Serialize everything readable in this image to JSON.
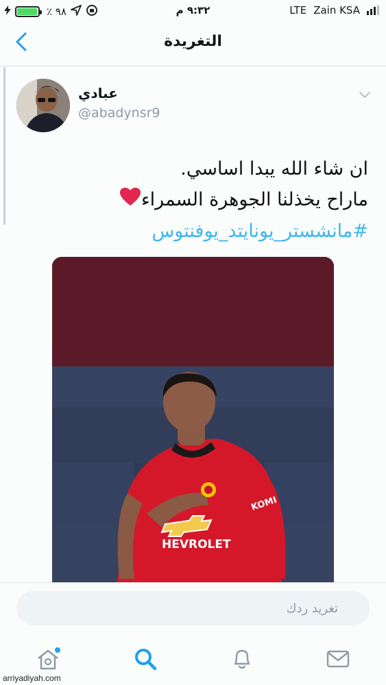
{
  "status_bar": {
    "battery_percent": "٪ ٩٨",
    "battery_level": 0.98,
    "time": "٩:٣٢ م",
    "network": "LTE",
    "carrier": "Zain KSA"
  },
  "nav": {
    "title": "التغريدة",
    "back_icon": "chevron-left-icon"
  },
  "tweet": {
    "author_name": "عبادي",
    "author_handle": "@abadynsr9",
    "lines": [
      "ان شاء الله يبدا اساسي.",
      "ماراح يخذلنا الجوهرة السمراء"
    ],
    "emoji": "heart-icon",
    "hashtag": "#مانشستر_يونايتد_يوفنتوس"
  },
  "media": {
    "shirt_text_sponsor": "HEVROLET",
    "sleeve_text": "KOMI",
    "colors": {
      "top_band": "#5a1a28",
      "shirt": "#d4182a"
    }
  },
  "reply": {
    "placeholder": "تغريد ردك"
  },
  "tab_bar": {
    "items": [
      "home-icon",
      "search-icon",
      "notifications-icon",
      "messages-icon"
    ],
    "accent": "#1da1f2"
  },
  "watermark": "arriyadiyah.com"
}
